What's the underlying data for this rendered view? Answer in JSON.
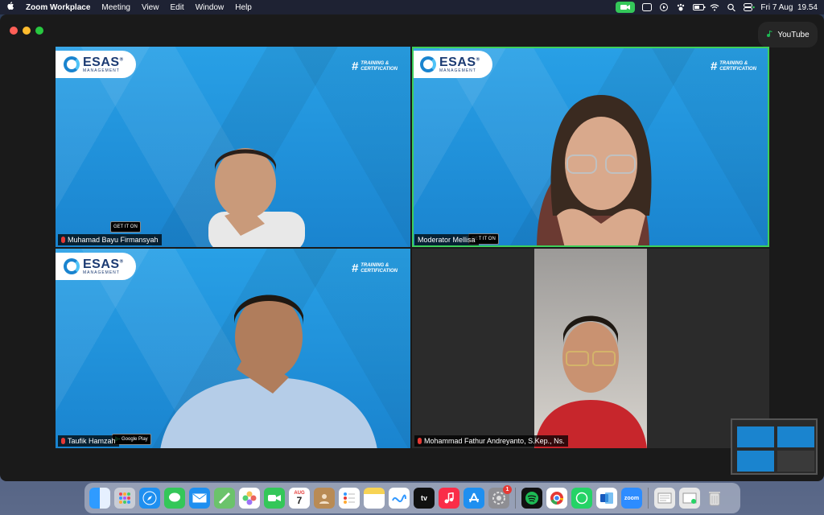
{
  "menubar": {
    "apple": "",
    "app_name": "Zoom Workplace",
    "items": [
      "Meeting",
      "View",
      "Edit",
      "Window",
      "Help"
    ],
    "clock": "Fri 7 Aug  19.54"
  },
  "youtube": {
    "label": "YouTube"
  },
  "branding": {
    "logo_main": "ESAS",
    "logo_reg": "®",
    "logo_sub": "MANAGEMENT",
    "tag_hash": "#",
    "tag_line1": "TRAINING &",
    "tag_line2": "CERTIFICATION",
    "gplay_label": "Google Play",
    "gplay_small": "GET IT ON"
  },
  "participants": [
    {
      "name": "Muhamad Bayu Firmansyah",
      "muted": true
    },
    {
      "name": "Moderator Mellisa",
      "muted": false,
      "active": true
    },
    {
      "name": "Taufik Hamzah",
      "muted": true
    },
    {
      "name": "Mohammad Fathur Andreyanto, S.Kep., Ns.",
      "muted": true
    }
  ],
  "dock": {
    "calendar_month": "AUG",
    "calendar_day": "7",
    "tv_label": "tv",
    "zoom_label": "zoom",
    "settings_badge": "1"
  },
  "colors": {
    "active_speaker": "#3ecf5a",
    "esas_blue": "#1a84cf",
    "zoom_green": "#34c759"
  }
}
